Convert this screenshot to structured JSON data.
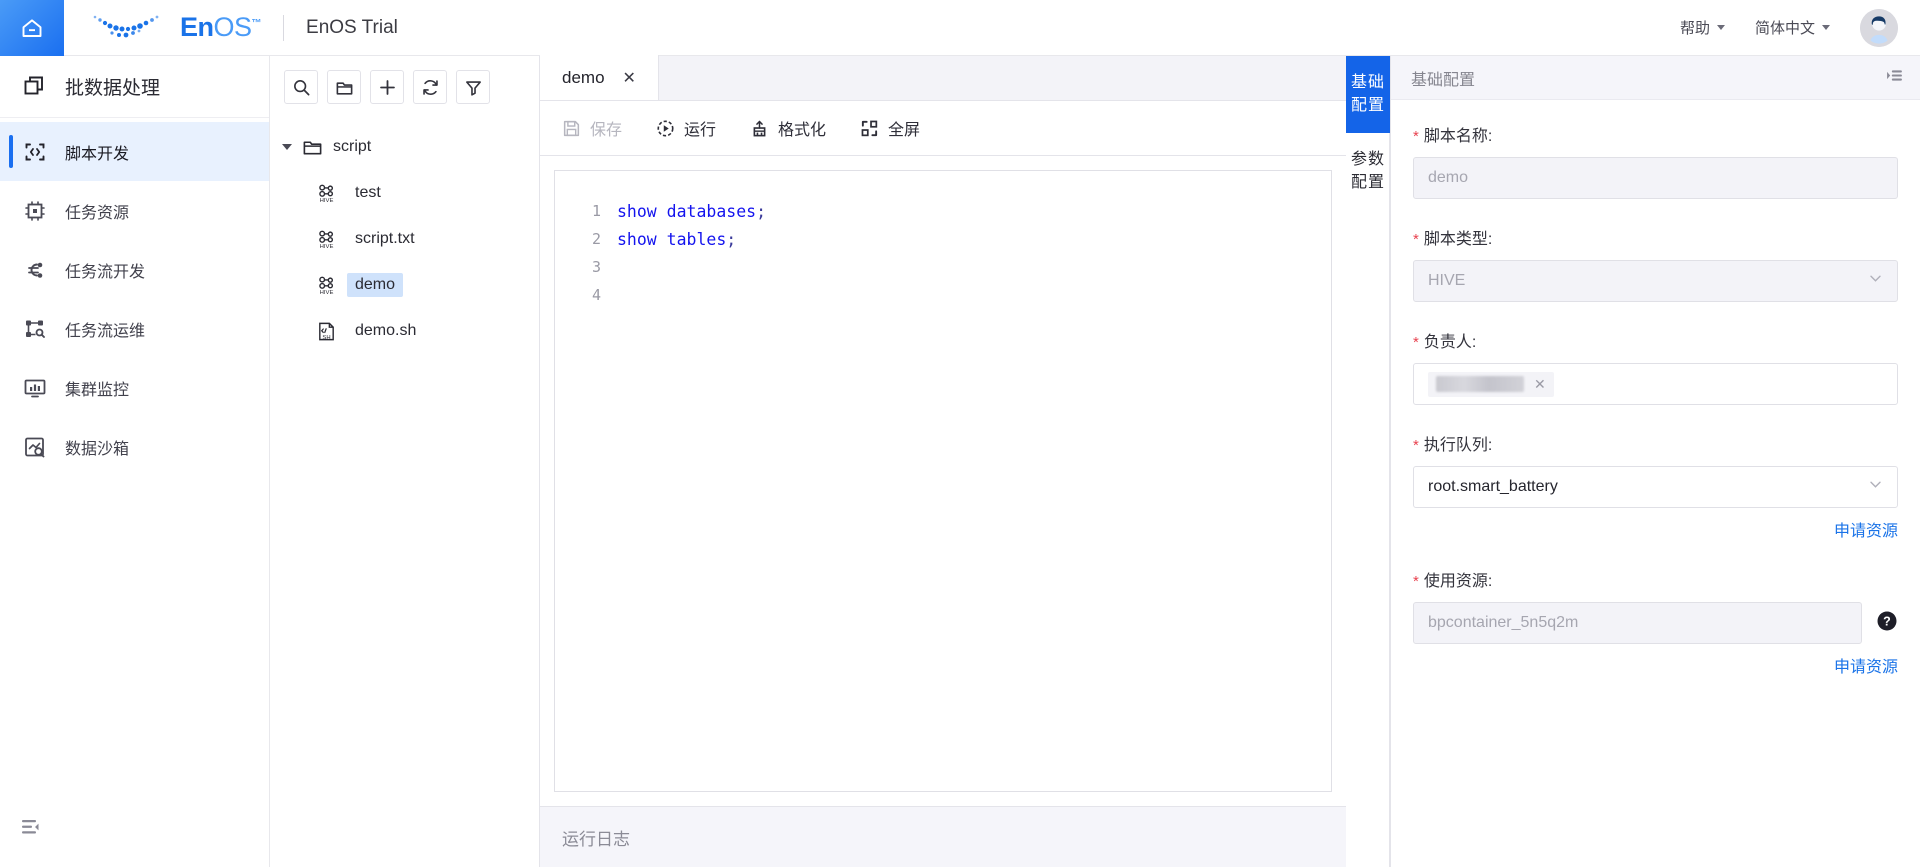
{
  "topbar": {
    "home_icon": "home-icon",
    "logo_en": "En",
    "logo_os": "OS",
    "logo_tm": "™",
    "title": "EnOS Trial",
    "help_label": "帮助",
    "lang_label": "简体中文",
    "avatar": "user-avatar"
  },
  "sidebar": {
    "header": {
      "label": "批数据处理",
      "icon": "batch-data-icon"
    },
    "items": [
      {
        "label": "脚本开发",
        "icon": "code-brackets-icon",
        "active": true
      },
      {
        "label": "任务资源",
        "icon": "chip-icon",
        "active": false
      },
      {
        "label": "任务流开发",
        "icon": "workflow-icon",
        "active": false
      },
      {
        "label": "任务流运维",
        "icon": "nodes-search-icon",
        "active": false
      },
      {
        "label": "集群监控",
        "icon": "monitor-chart-icon",
        "active": false
      },
      {
        "label": "数据沙箱",
        "icon": "image-search-icon",
        "active": false
      }
    ],
    "collapse_icon": "collapse-sidebar-icon"
  },
  "filetree": {
    "toolbar": [
      {
        "name": "search-icon",
        "label": "搜索"
      },
      {
        "name": "folder-icon",
        "label": "新建文件夹"
      },
      {
        "name": "plus-icon",
        "label": "新建"
      },
      {
        "name": "refresh-icon",
        "label": "刷新"
      },
      {
        "name": "filter-icon",
        "label": "筛选"
      }
    ],
    "root": {
      "label": "script",
      "expanded": true
    },
    "files": [
      {
        "label": "test",
        "type": "HIVE",
        "selected": false
      },
      {
        "label": "script.txt",
        "type": "HIVE",
        "selected": false
      },
      {
        "label": "demo",
        "type": "HIVE",
        "selected": true
      },
      {
        "label": "demo.sh",
        "type": "SH",
        "selected": false
      }
    ]
  },
  "editor": {
    "tab": {
      "label": "demo",
      "close": "✕"
    },
    "toolbar": [
      {
        "label": "保存",
        "icon": "save-icon",
        "disabled": true
      },
      {
        "label": "运行",
        "icon": "run-icon",
        "disabled": false
      },
      {
        "label": "格式化",
        "icon": "format-icon",
        "disabled": false
      },
      {
        "label": "全屏",
        "icon": "fullscreen-icon",
        "disabled": false
      }
    ],
    "code_lines": [
      {
        "num": "1",
        "kw": "show databases",
        "punc": ";"
      },
      {
        "num": "2",
        "kw": "show tables",
        "punc": ";"
      },
      {
        "num": "3",
        "kw": "",
        "punc": ""
      },
      {
        "num": "4",
        "kw": "",
        "punc": ""
      }
    ],
    "log_label": "运行日志"
  },
  "vtabs": [
    {
      "label": "基础配置",
      "active": true
    },
    {
      "label": "参数配置",
      "active": false
    }
  ],
  "config": {
    "panel_title": "基础配置",
    "collapse_icon": "panel-collapse-icon",
    "script_name": {
      "label": "脚本名称:",
      "value": "demo",
      "readonly": true
    },
    "script_type": {
      "label": "脚本类型:",
      "value": "HIVE",
      "readonly": true,
      "chevron": "chevron-down-icon"
    },
    "owner": {
      "label": "负责人:",
      "tag_redacted": true,
      "tag_close": "✕"
    },
    "queue": {
      "label": "执行队列:",
      "value": "root.smart_battery",
      "readonly": false,
      "chevron": "chevron-down-icon",
      "link": "申请资源"
    },
    "resource": {
      "label": "使用资源:",
      "value": "bpcontainer_5n5q2m",
      "readonly": true,
      "help": "question-icon",
      "link": "申请资源"
    }
  },
  "colors": {
    "accent": "#1a6ff0",
    "vtab_active": "#1464e8",
    "link": "#1a73e8",
    "required": "#e8424f",
    "code_keyword": "#1414ee",
    "selection": "#cfe2fb"
  }
}
